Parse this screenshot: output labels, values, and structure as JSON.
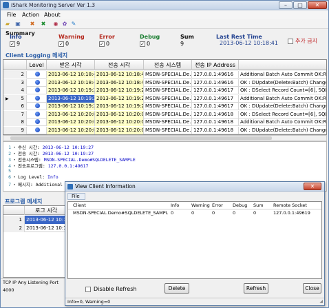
{
  "window": {
    "title": "iShark Monitoring Server Ver 1.3",
    "minimize": "–",
    "maximize": "□",
    "close": "✕"
  },
  "menu": [
    "File",
    "Action",
    "About"
  ],
  "toolbar": {
    "icons": [
      "folder-icon",
      "save-icon",
      "delete-icon",
      "x-icon",
      "globe-icon",
      "gear-icon",
      "pencil-icon"
    ]
  },
  "summary": {
    "label": "Summary",
    "info": {
      "label": "Info",
      "value": "9"
    },
    "warning": {
      "label": "Warning",
      "value": "0"
    },
    "error": {
      "label": "Error",
      "value": "0"
    },
    "debug": {
      "label": "Debug",
      "value": "0"
    },
    "sum": {
      "label": "Sum",
      "value": "9"
    },
    "last_rest_time": {
      "label": "Last Rest Time",
      "value": "2013-06-12 10:18:41"
    },
    "ban_label": "추가 금지"
  },
  "colors": {
    "accent": "#2d5fa8",
    "time_bg": "#ffffc8",
    "selected": "#3966c6",
    "ban": "#c0282a"
  },
  "client_logging": {
    "title": "Client Logging 메세지",
    "columns": [
      "Level",
      "받은 시각",
      "전송 시각",
      "전송 시스템",
      "전송 IP Address",
      ""
    ],
    "rows": [
      {
        "num": "2",
        "received": "2013-06-12 10:18:48",
        "sent": "2013-06-12 10:18:48",
        "system": "MSDN-SPECIAL.De...",
        "ip": "127.0.0.1:49616",
        "msg": "Additional Batch Auto Commit OK:Record"
      },
      {
        "num": "3",
        "received": "2013-06-12 10:18:49",
        "sent": "2013-06-12 10:18:49",
        "system": "MSDN-SPECIAL.De...",
        "ip": "127.0.0.1:49616",
        "msg": "OK : DUpdate(Delete:Batch) Changed Co"
      },
      {
        "num": "4",
        "received": "2013-06-12 10:19:26",
        "sent": "2013-06-12 10:19:26",
        "system": "MSDN-SPECIAL.De...",
        "ip": "127.0.0.1:49617",
        "msg": "OK : DSelect Record Count=[6], SQL siz"
      },
      {
        "num": "5",
        "received": "2013-06-12 10:19:27",
        "sent": "2013-06-12 10:19:27",
        "system": "MSDN-SPECIAL.De...",
        "ip": "127.0.0.1:49617",
        "msg": "Additional Batch Auto Commit OK:Record"
      },
      {
        "num": "6",
        "received": "2013-06-12 10:19:27",
        "sent": "2013-06-12 10:19:27",
        "system": "MSDN-SPECIAL.De...",
        "ip": "127.0.0.1:49617",
        "msg": "OK : DUpdate(Delete:Batch) Changed Co"
      },
      {
        "num": "7",
        "received": "2013-06-12 10:20:03",
        "sent": "2013-06-12 10:20:03",
        "system": "MSDN-SPECIAL.De...",
        "ip": "127.0.0.1:49618",
        "msg": "OK : DSelect Record Count=[6], SQL siz"
      },
      {
        "num": "8",
        "received": "2013-06-12 10:20:04",
        "sent": "2013-06-12 10:20:04",
        "system": "MSDN-SPECIAL.De...",
        "ip": "127.0.0.1:49618",
        "msg": "Additional Batch Auto Commit OK:Record"
      },
      {
        "num": "9",
        "received": "2013-06-12 10:20:04",
        "sent": "2013-06-12 10:20:04",
        "system": "MSDN-SPECIAL.De...",
        "ip": "127.0.0.1:49618",
        "msg": "OK : DUpdate(Delete:Batch) Changed Co"
      }
    ]
  },
  "detail": {
    "lines": [
      {
        "num": "1",
        "text": "수신 시간: ",
        "value": "2013-06-12 10:19:27"
      },
      {
        "num": "2",
        "text": "전송 시간: ",
        "value": "2013-06-12 10:19:27"
      },
      {
        "num": "3",
        "text": "전송시스템: ",
        "value": "MSDN-SPECIAL.Demo#SQLDELETE_SAMPLE"
      },
      {
        "num": "4",
        "text": "전송프로그램: ",
        "value": "127.0.0.1:49617"
      },
      {
        "num": "5",
        "text": "",
        "value": ""
      },
      {
        "num": "6",
        "text": "Log Level: ",
        "value": "Info"
      },
      {
        "num": "7",
        "text": "메시지: Additional Batch Auto ",
        "keyword": "Commit",
        "value": " OK:Record=[6] AutoCommitCount=[10000]"
      }
    ]
  },
  "program_messages": {
    "title": "프로그램 메세지",
    "columns": [
      "",
      "로그 시각"
    ],
    "rows": [
      {
        "num": "1",
        "time": "2013-06-12 10:18:40"
      },
      {
        "num": "2",
        "time": "2013-06-12 10:18:41"
      }
    ]
  },
  "status": "TCP IP Any Listening Port 4000",
  "dialog": {
    "title": "View Client Information",
    "menu": "File",
    "columns": [
      "Client",
      "Info",
      "Warning",
      "Error",
      "Debug",
      "Sum",
      "Remote Socket"
    ],
    "rows": [
      {
        "client": "MSDN-SPECIAL.Demo#SQLDELETE_SAMPLE",
        "info": "0",
        "warning": "0",
        "error": "0",
        "debug": "0",
        "sum": "0",
        "socket": "127.0.0.1:49619"
      }
    ],
    "disable_refresh": "Disable Refresh",
    "delete": "Delete",
    "refresh": "Refresh",
    "close": "Close",
    "status": "Info=0, Warning=0",
    "win_close": "✕"
  }
}
